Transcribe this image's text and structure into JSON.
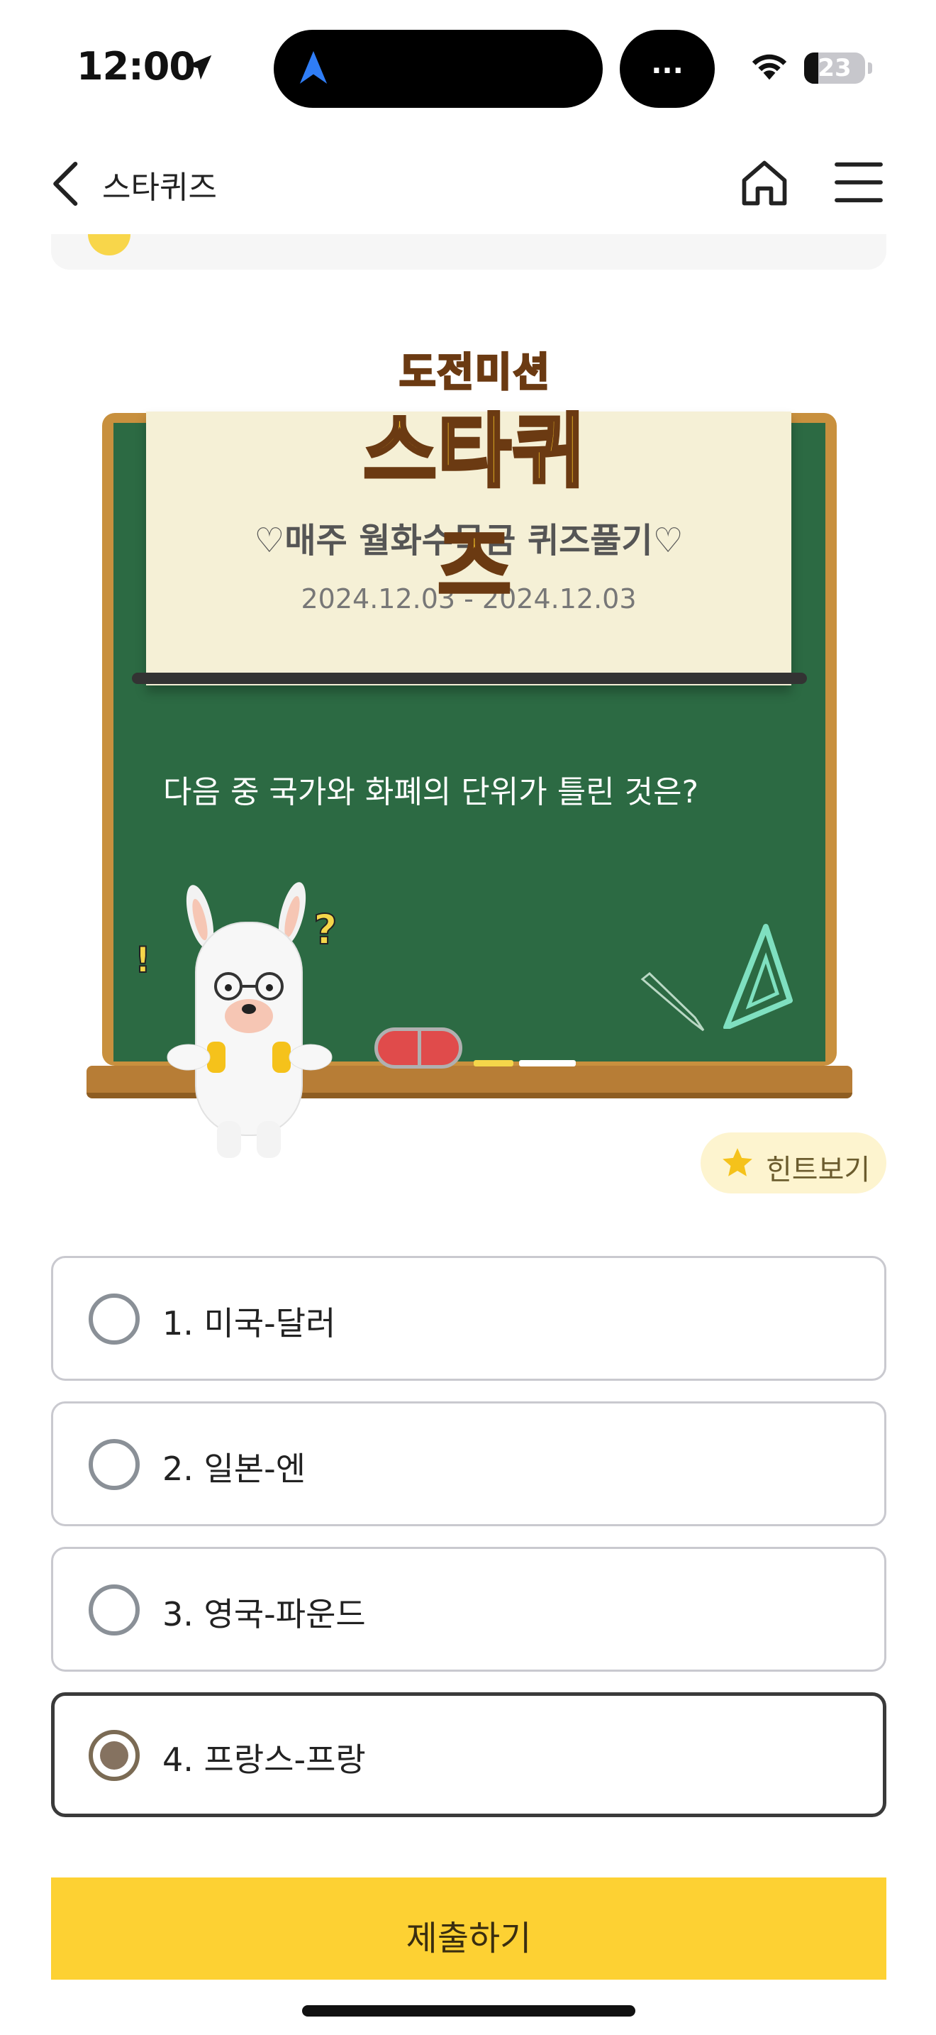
{
  "status_bar": {
    "time": "12:00",
    "island_more": "...",
    "battery_level": "23",
    "battery_fraction": 0.23
  },
  "nav": {
    "title": "스타퀴즈",
    "back_icon": "chevron-left-icon",
    "home_icon": "home-icon",
    "menu_icon": "hamburger-menu-icon"
  },
  "board": {
    "logo_top": "도전미션",
    "logo_main": "스타퀴즈",
    "quiz_title": "♡매주 월화수목금 퀴즈풀기♡",
    "date_range": "2024.12.03 - 2024.12.03",
    "question": "다음 중 국가와 화폐의 단위가 틀린 것은?"
  },
  "hint": {
    "label": "힌트보기",
    "icon": "star-icon"
  },
  "options": [
    {
      "label": "1. 미국-달러",
      "selected": false
    },
    {
      "label": "2. 일본-엔",
      "selected": false
    },
    {
      "label": "3. 영국-파운드",
      "selected": false
    },
    {
      "label": "4. 프랑스-프랑",
      "selected": true
    }
  ],
  "submit": {
    "label": "제출하기"
  },
  "colors": {
    "accent": "#fdd133",
    "board_green": "#2c6a43",
    "frame_wood": "#c8903e",
    "selected_radio": "#857260"
  }
}
